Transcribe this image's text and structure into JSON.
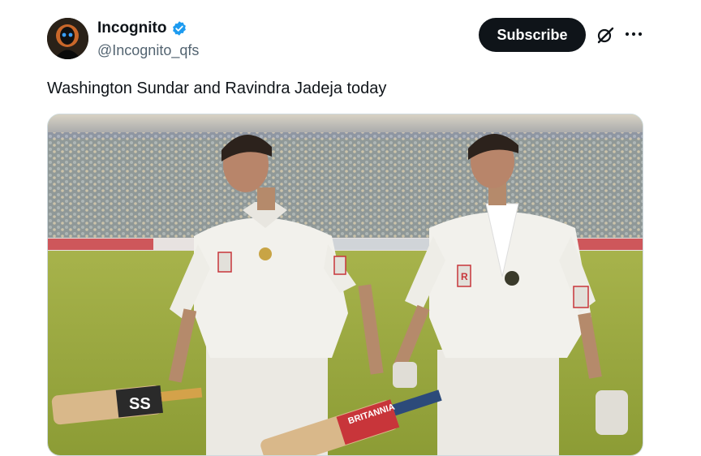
{
  "author": {
    "display_name": "Incognito",
    "handle": "@Incognito_qfs",
    "verified": true,
    "avatar_icon": "avatar-masked-figure"
  },
  "actions": {
    "subscribe_label": "Subscribe",
    "grok_icon": "grok-icon",
    "more_icon": "more-icon"
  },
  "tweet": {
    "text": "Washington Sundar and Ravindra Jadeja today"
  },
  "media": {
    "kind": "photo",
    "jersey_logo_text": "R",
    "bat_brand_text": "BRITANNIA",
    "bat_left_text": "SS"
  },
  "colors": {
    "text_primary": "#0f1419",
    "text_secondary": "#536471",
    "verified_blue": "#1d9bf0",
    "subscribe_bg": "#0f1419"
  }
}
